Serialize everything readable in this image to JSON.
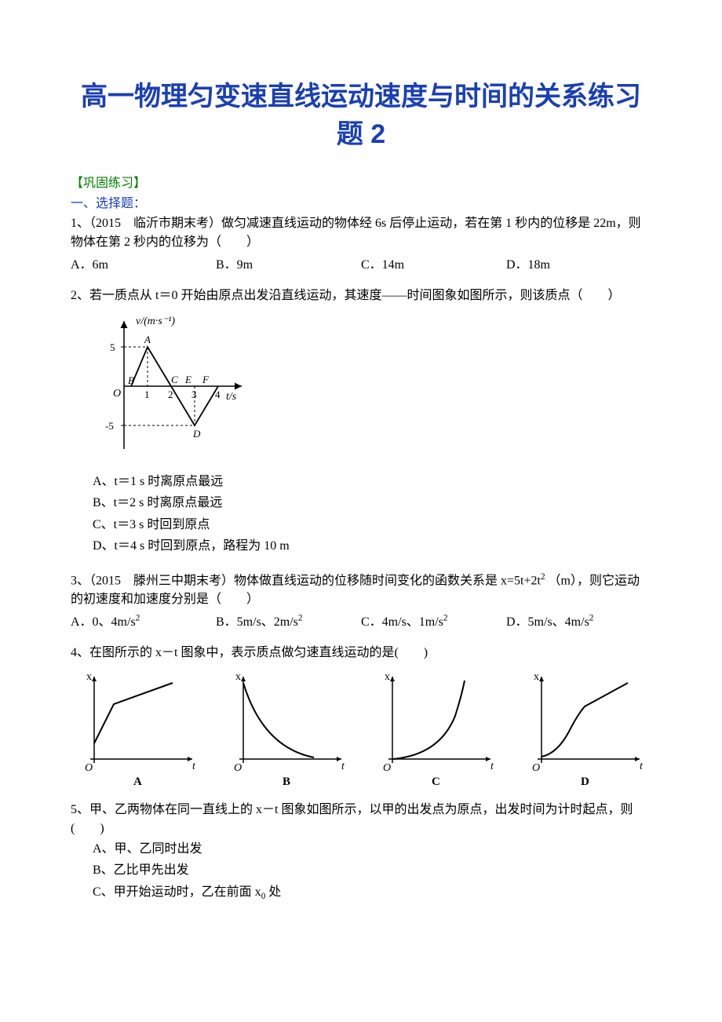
{
  "title": "高一物理匀变速直线运动速度与时间的关系练习题 2",
  "section_label": "【巩固练习】",
  "sub_label": "一、选择题：",
  "q1": {
    "text": "1、（2015　临沂市期末考）做匀减速直线运动的物体经 6s 后停止运动，若在第 1 秒内的位移是 22m，则物体在第 2 秒内的位移为（　　）",
    "A": "A．6m",
    "B": "B．9m",
    "C": "C．14m",
    "D": "D．18m"
  },
  "q2": {
    "text": "2、若一质点从 t＝0 开始由原点出发沿直线运动，其速度——时间图象如图所示，则该质点（　　）",
    "A": "A、t＝1 s 时离原点最远",
    "B": "B、t＝2 s 时离原点最远",
    "C": "C、t＝3 s 时回到原点",
    "D": "D、t＝4 s 时回到原点，路程为 10 m",
    "graph": {
      "ylabel": "v/(m·s⁻¹)",
      "xlabel": "t/s",
      "y_ticks": [
        "5",
        "-5"
      ],
      "x_ticks": [
        "1",
        "2",
        "3",
        "4"
      ],
      "point_labels": [
        "A",
        "B",
        "C",
        "D",
        "E",
        "F"
      ]
    }
  },
  "q3": {
    "text_a": "3、（2015　滕州三中期末考）物体做直线运动的位移随时间变化的函数关系是 x=5t+2t",
    "text_b": "（m），则它运动的初速度和加速度分别是（　　）",
    "A_a": "A．0、4m/s",
    "A_sup": "2",
    "B_a": "B．5m/s、2m/s",
    "B_sup": "2",
    "C_a": "C．4m/s、1m/s",
    "C_sup": "2",
    "D_a": "D．5m/s、4m/s",
    "D_sup": "2"
  },
  "q4": {
    "text": "4、在图所示的 x－t 图象中，表示质点做匀速直线运动的是(　　)",
    "labels": {
      "A": "A",
      "B": "B",
      "C": "C",
      "D": "D",
      "y": "x",
      "x": "t",
      "o": "O"
    }
  },
  "q5": {
    "text": "5、甲、乙两物体在同一直线上的 x－t 图象如图所示，以甲的出发点为原点，出发时间为计时起点，则(　　)",
    "A": "A、甲、乙同时出发",
    "B": "B、乙比甲先出发",
    "C_a": "C、甲开始运动时，乙在前面 x",
    "C_sub": "0",
    "C_b": " 处"
  }
}
